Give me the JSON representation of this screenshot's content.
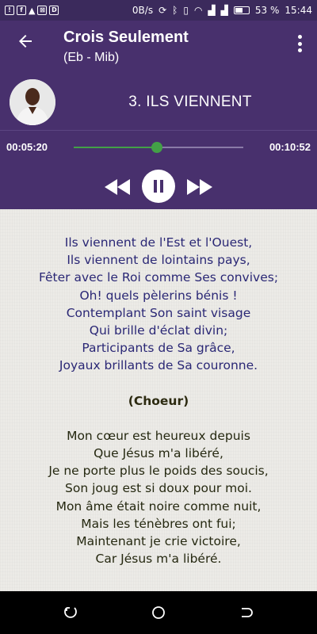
{
  "status_bar": {
    "speed": "0B/s",
    "battery_percent": "53 %",
    "time": "15:44"
  },
  "app_bar": {
    "title": "Crois Seulement",
    "subtitle": "(Eb - Mib)"
  },
  "player": {
    "song_title": "3. ILS VIENNENT",
    "current_time": "00:05:20",
    "total_time": "00:10:52",
    "progress": 0.49,
    "accent_color": "#43a047",
    "bg_color": "#48306d"
  },
  "lyrics": {
    "verse1": [
      "Ils viennent de l'Est et l'Ouest,",
      "Ils viennent de lointains pays,",
      "Fêter avec le Roi comme Ses convives;",
      "Oh! quels pèlerins bénis !",
      "Contemplant Son saint visage",
      "Qui brille d'éclat divin;",
      "Participants de Sa grâce,",
      "Joyaux brillants de Sa couronne."
    ],
    "chorus_title": "(Choeur)",
    "chorus": [
      "Mon cœur est heureux depuis",
      "Que Jésus m'a libéré,",
      "Je ne porte plus le poids des soucis,",
      "Son joug est si doux pour moi.",
      "Mon âme était noire comme nuit,",
      "Mais les ténèbres ont fui;",
      "Maintenant je crie victoire,",
      "Car Jésus m'a libéré."
    ]
  }
}
